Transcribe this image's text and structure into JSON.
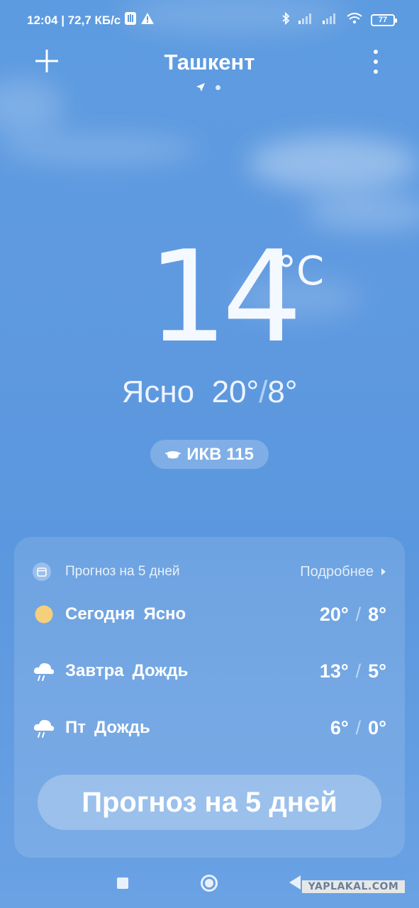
{
  "status_bar": {
    "time_and_speed": "12:04 | 72,7 КБ/с",
    "battery": "77"
  },
  "header": {
    "city": "Ташкент"
  },
  "current": {
    "temperature": "14",
    "unit": "°C",
    "condition": "Ясно",
    "high": "20°",
    "low": "8°",
    "aqi_label": "ИКВ 115"
  },
  "forecast": {
    "title": "Прогноз на 5 дней",
    "more_label": "Подробнее",
    "days": [
      {
        "day": "Сегодня",
        "condition": "Ясно",
        "high": "20°",
        "low": "8°",
        "icon": "sun-icon"
      },
      {
        "day": "Завтра",
        "condition": "Дождь",
        "high": "13°",
        "low": "5°",
        "icon": "rain-icon"
      },
      {
        "day": "Пт",
        "condition": "Дождь",
        "high": "6°",
        "low": "0°",
        "icon": "rain-icon"
      }
    ],
    "button_label": "Прогноз на 5 дней"
  },
  "watermark": "YAPLAKAL.COM"
}
